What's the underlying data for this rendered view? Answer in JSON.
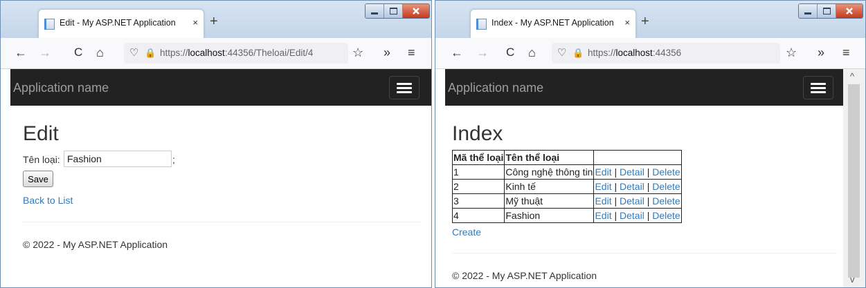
{
  "left_window": {
    "tab_title": "Edit - My ASP.NET Application",
    "tab_close": "×",
    "new_tab": "+",
    "url": {
      "prefix": "https://",
      "host": "localhost",
      "rest": ":44356/Theloai/Edit/4"
    },
    "brand": "Application name",
    "heading": "Edit",
    "form": {
      "label": "Tên loại:",
      "value": "Fashion",
      "suffix": ";",
      "save_label": "Save"
    },
    "back_link": "Back to List",
    "footer": "© 2022 - My ASP.NET Application"
  },
  "right_window": {
    "tab_title": "Index - My ASP.NET Application",
    "tab_close": "×",
    "new_tab": "+",
    "url": {
      "prefix": "https://",
      "host": "localhost",
      "rest": ":44356"
    },
    "brand": "Application name",
    "heading": "Index",
    "table": {
      "headers": [
        "Mã thể loại",
        "Tên thể loại",
        ""
      ],
      "rows": [
        {
          "id": "1",
          "name": "Công nghệ thông tin"
        },
        {
          "id": "2",
          "name": "Kinh tế"
        },
        {
          "id": "3",
          "name": "Mỹ thuật"
        },
        {
          "id": "4",
          "name": "Fashion"
        }
      ],
      "actions": {
        "edit": "Edit",
        "detail": "Detail",
        "delete": "Delete",
        "separator": "|"
      }
    },
    "create_link": "Create",
    "footer": "© 2022 - My ASP.NET Application"
  },
  "toolbar_glyphs": {
    "back": "←",
    "forward": "→",
    "reload": "C",
    "home": "⌂",
    "shield": "♡",
    "lock": "🔒",
    "star": "☆",
    "more": "»",
    "menu": "≡"
  },
  "colors": {
    "navbar_dark": "#222222",
    "link": "#337ab7",
    "close_button": "#c5391c"
  }
}
